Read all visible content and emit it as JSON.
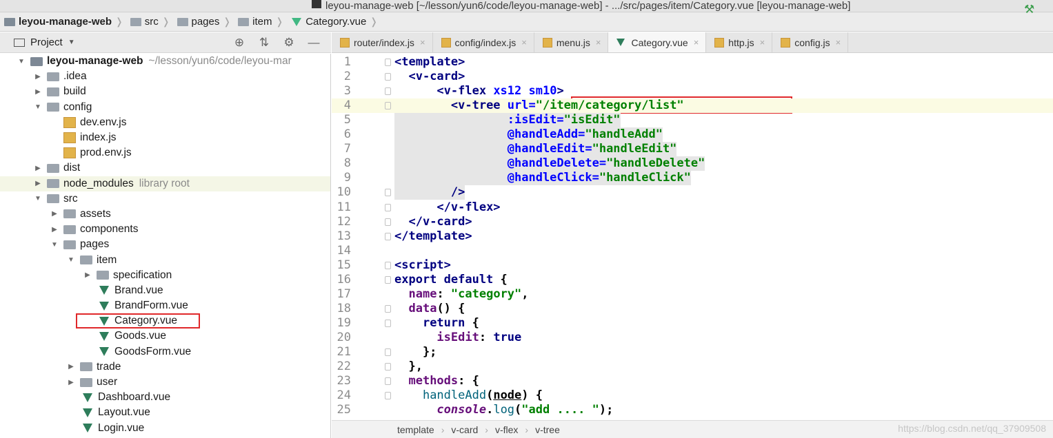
{
  "window": {
    "title": "leyou-manage-web [~/lesson/yun6/code/leyou-manage-web] - .../src/pages/item/Category.vue [leyou-manage-web]"
  },
  "breadcrumb": [
    {
      "label": "leyou-manage-web",
      "icon": "project-folder-icon"
    },
    {
      "label": "src",
      "icon": "folder-icon"
    },
    {
      "label": "pages",
      "icon": "folder-icon"
    },
    {
      "label": "item",
      "icon": "folder-icon"
    },
    {
      "label": "Category.vue",
      "icon": "vue-file-icon"
    }
  ],
  "project_panel": {
    "title": "Project",
    "tree": [
      {
        "depth": 0,
        "arrow": "down",
        "icon": "root",
        "name": "leyou-manage-web",
        "hint": "~/lesson/yun6/code/leyou-mar",
        "bold": true
      },
      {
        "depth": 1,
        "arrow": "right",
        "icon": "folder",
        "name": ".idea"
      },
      {
        "depth": 1,
        "arrow": "right",
        "icon": "folder",
        "name": "build"
      },
      {
        "depth": 1,
        "arrow": "down",
        "icon": "folder",
        "name": "config"
      },
      {
        "depth": 2,
        "arrow": "",
        "icon": "js",
        "name": "dev.env.js"
      },
      {
        "depth": 2,
        "arrow": "",
        "icon": "js",
        "name": "index.js"
      },
      {
        "depth": 2,
        "arrow": "",
        "icon": "js",
        "name": "prod.env.js"
      },
      {
        "depth": 1,
        "arrow": "right",
        "icon": "folder",
        "name": "dist"
      },
      {
        "depth": 1,
        "arrow": "right",
        "icon": "folder",
        "name": "node_modules",
        "hint": "library root",
        "highlight": true
      },
      {
        "depth": 1,
        "arrow": "down",
        "icon": "folder",
        "name": "src"
      },
      {
        "depth": 2,
        "arrow": "right",
        "icon": "folder",
        "name": "assets"
      },
      {
        "depth": 2,
        "arrow": "right",
        "icon": "folder",
        "name": "components"
      },
      {
        "depth": 2,
        "arrow": "down",
        "icon": "folder",
        "name": "pages"
      },
      {
        "depth": 3,
        "arrow": "down",
        "icon": "folder",
        "name": "item"
      },
      {
        "depth": 4,
        "arrow": "right",
        "icon": "folder",
        "name": "specification"
      },
      {
        "depth": 4,
        "arrow": "",
        "icon": "vue",
        "name": "Brand.vue"
      },
      {
        "depth": 4,
        "arrow": "",
        "icon": "vue",
        "name": "BrandForm.vue"
      },
      {
        "depth": 4,
        "arrow": "",
        "icon": "vue",
        "name": "Category.vue",
        "boxed": true
      },
      {
        "depth": 4,
        "arrow": "",
        "icon": "vue",
        "name": "Goods.vue"
      },
      {
        "depth": 4,
        "arrow": "",
        "icon": "vue",
        "name": "GoodsForm.vue"
      },
      {
        "depth": 3,
        "arrow": "right",
        "icon": "folder",
        "name": "trade"
      },
      {
        "depth": 3,
        "arrow": "right",
        "icon": "folder",
        "name": "user"
      },
      {
        "depth": 3,
        "arrow": "",
        "icon": "vue",
        "name": "Dashboard.vue"
      },
      {
        "depth": 3,
        "arrow": "",
        "icon": "vue",
        "name": "Layout.vue"
      },
      {
        "depth": 3,
        "arrow": "",
        "icon": "vue",
        "name": "Login.vue"
      }
    ]
  },
  "tabs": [
    {
      "label": "router/index.js",
      "icon": "js",
      "active": false
    },
    {
      "label": "config/index.js",
      "icon": "js",
      "active": false
    },
    {
      "label": "menu.js",
      "icon": "js",
      "active": false
    },
    {
      "label": "Category.vue",
      "icon": "vue",
      "active": true
    },
    {
      "label": "http.js",
      "icon": "js",
      "active": false
    },
    {
      "label": "config.js",
      "icon": "js",
      "active": false
    }
  ],
  "code_lines": [
    {
      "n": "1",
      "fold": true,
      "sel": false,
      "parts": [
        [
          "tag",
          "<template>"
        ]
      ]
    },
    {
      "n": "2",
      "fold": true,
      "sel": false,
      "parts": [
        [
          "plain",
          "  "
        ],
        [
          "tag",
          "<v-card>"
        ]
      ]
    },
    {
      "n": "3",
      "fold": true,
      "sel": false,
      "parts": [
        [
          "plain",
          "      "
        ],
        [
          "tag",
          "<v-flex "
        ],
        [
          "attr",
          "xs12 sm10"
        ],
        [
          "tag",
          ">"
        ]
      ]
    },
    {
      "n": "4",
      "fold": true,
      "sel": false,
      "caret": true,
      "parts": [
        [
          "plain",
          "        "
        ],
        [
          "tag",
          "<v-tree "
        ],
        [
          "attr",
          "url="
        ],
        [
          "str",
          "\"/item/category/list\""
        ]
      ]
    },
    {
      "n": "5",
      "fold": false,
      "sel": true,
      "parts": [
        [
          "plain",
          "                "
        ],
        [
          "attr",
          ":isEdit="
        ],
        [
          "str",
          "\"isEdit\""
        ]
      ]
    },
    {
      "n": "6",
      "fold": false,
      "sel": true,
      "parts": [
        [
          "plain",
          "                "
        ],
        [
          "attr",
          "@handleAdd="
        ],
        [
          "str",
          "\"handleAdd\""
        ]
      ]
    },
    {
      "n": "7",
      "fold": false,
      "sel": true,
      "parts": [
        [
          "plain",
          "                "
        ],
        [
          "attr",
          "@handleEdit="
        ],
        [
          "str",
          "\"handleEdit\""
        ]
      ]
    },
    {
      "n": "8",
      "fold": false,
      "sel": true,
      "parts": [
        [
          "plain",
          "                "
        ],
        [
          "attr",
          "@handleDelete="
        ],
        [
          "str",
          "\"handleDelete\""
        ]
      ]
    },
    {
      "n": "9",
      "fold": false,
      "sel": true,
      "parts": [
        [
          "plain",
          "                "
        ],
        [
          "attr",
          "@handleClick="
        ],
        [
          "str",
          "\"handleClick\""
        ]
      ]
    },
    {
      "n": "10",
      "fold": true,
      "sel": true,
      "parts": [
        [
          "plain",
          "        "
        ],
        [
          "tag",
          "/>"
        ]
      ]
    },
    {
      "n": "11",
      "fold": true,
      "sel": false,
      "parts": [
        [
          "plain",
          "      "
        ],
        [
          "tag",
          "</v-flex>"
        ]
      ]
    },
    {
      "n": "12",
      "fold": true,
      "sel": false,
      "parts": [
        [
          "plain",
          "  "
        ],
        [
          "tag",
          "</v-card>"
        ]
      ]
    },
    {
      "n": "13",
      "fold": true,
      "sel": false,
      "parts": [
        [
          "tag",
          "</template>"
        ]
      ]
    },
    {
      "n": "14",
      "fold": false,
      "sel": false,
      "parts": []
    },
    {
      "n": "15",
      "fold": true,
      "sel": false,
      "parts": [
        [
          "tag",
          "<script>"
        ]
      ]
    },
    {
      "n": "16",
      "fold": true,
      "sel": false,
      "parts": [
        [
          "kw",
          "export default "
        ],
        [
          "plain",
          "{"
        ]
      ]
    },
    {
      "n": "17",
      "fold": false,
      "sel": false,
      "parts": [
        [
          "plain",
          "  "
        ],
        [
          "prop",
          "name"
        ],
        [
          "plain",
          ": "
        ],
        [
          "str",
          "\"category\""
        ],
        [
          "plain",
          ","
        ]
      ]
    },
    {
      "n": "18",
      "fold": true,
      "sel": false,
      "parts": [
        [
          "plain",
          "  "
        ],
        [
          "prop",
          "data"
        ],
        [
          "plain",
          "() {"
        ]
      ]
    },
    {
      "n": "19",
      "fold": true,
      "sel": false,
      "parts": [
        [
          "plain",
          "    "
        ],
        [
          "kw",
          "return "
        ],
        [
          "plain",
          "{"
        ]
      ]
    },
    {
      "n": "20",
      "fold": false,
      "sel": false,
      "parts": [
        [
          "plain",
          "      "
        ],
        [
          "prop",
          "isEdit"
        ],
        [
          "plain",
          ": "
        ],
        [
          "kw",
          "true"
        ]
      ]
    },
    {
      "n": "21",
      "fold": true,
      "sel": false,
      "parts": [
        [
          "plain",
          "    };"
        ]
      ]
    },
    {
      "n": "22",
      "fold": true,
      "sel": false,
      "parts": [
        [
          "plain",
          "  },"
        ]
      ]
    },
    {
      "n": "23",
      "fold": true,
      "sel": false,
      "parts": [
        [
          "plain",
          "  "
        ],
        [
          "prop",
          "methods"
        ],
        [
          "plain",
          ": {"
        ]
      ]
    },
    {
      "n": "24",
      "fold": true,
      "sel": false,
      "parts": [
        [
          "plain",
          "    "
        ],
        [
          "fn",
          "handleAdd"
        ],
        [
          "plain",
          "("
        ],
        [
          "under",
          "node"
        ],
        [
          "plain",
          ") {"
        ]
      ]
    },
    {
      "n": "25",
      "fold": false,
      "sel": false,
      "parts": [
        [
          "plain",
          "      "
        ],
        [
          "ital",
          "console"
        ],
        [
          "plain",
          "."
        ],
        [
          "fn",
          "log"
        ],
        [
          "plain",
          "("
        ],
        [
          "str",
          "\"add .... \""
        ],
        [
          "plain",
          ");"
        ]
      ]
    }
  ],
  "status_breadcrumb": [
    "template",
    "v-card",
    "v-flex",
    "v-tree"
  ],
  "watermark": "https://blog.csdn.net/qq_37909508",
  "colors": {
    "tag": "#000080",
    "attr": "#0000ff",
    "string": "#008000",
    "vue_icon": "#2e7d5b",
    "annotation_box": "#e0282a"
  }
}
